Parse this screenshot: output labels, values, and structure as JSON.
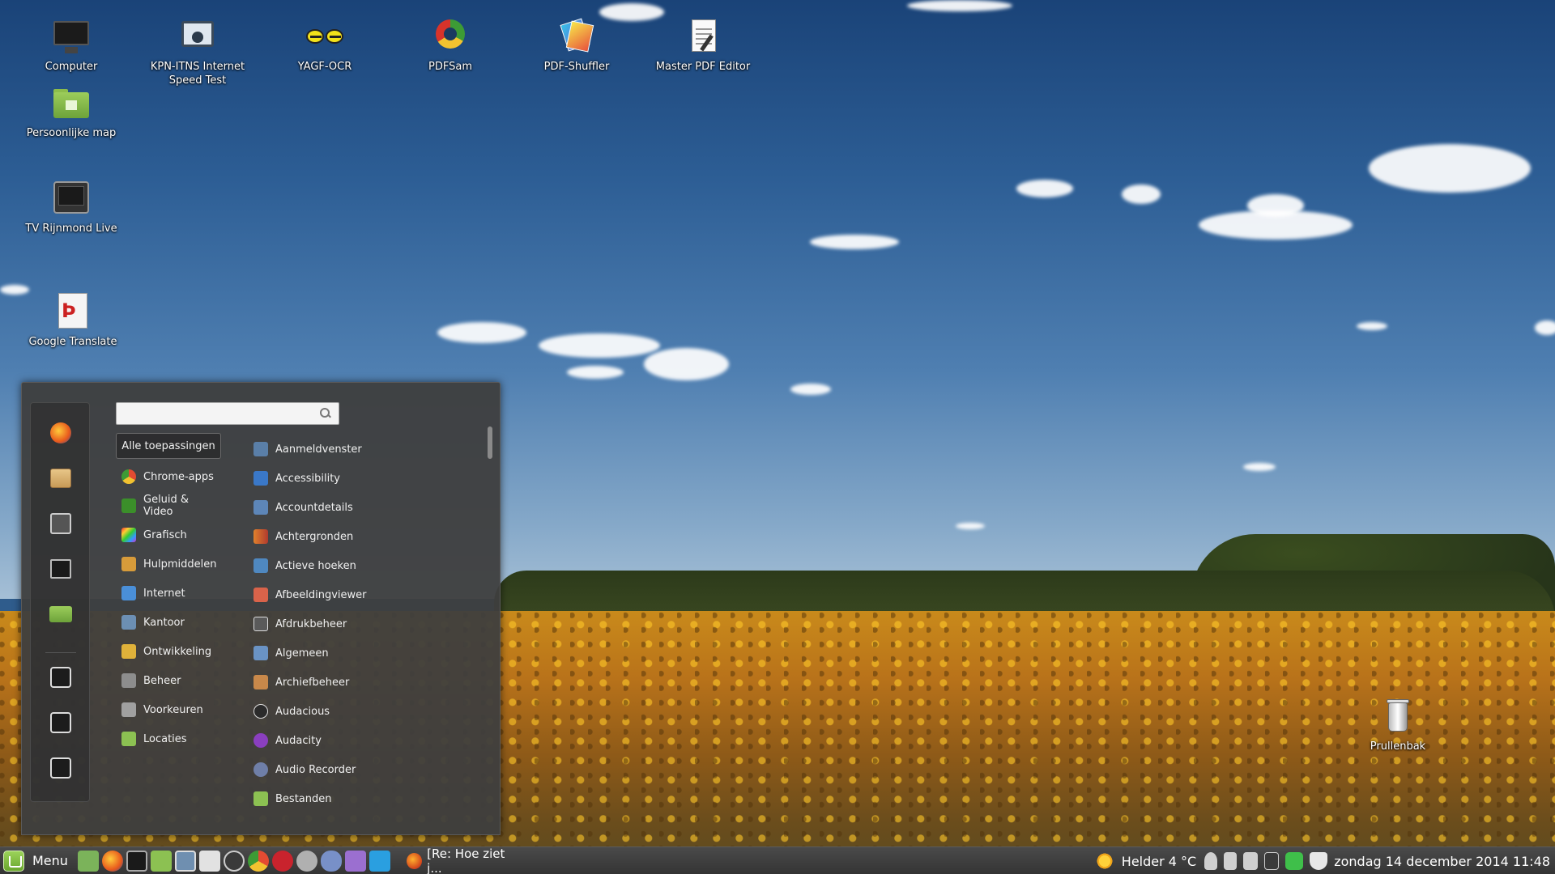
{
  "desktop": {
    "icons": [
      {
        "label": "Computer",
        "icon": "computer-icon"
      },
      {
        "label": "KPN-ITNS Internet Speed Test",
        "icon": "speedtest-icon"
      },
      {
        "label": "YAGF-OCR",
        "icon": "ocr-icon"
      },
      {
        "label": "PDFSam",
        "icon": "pdfsam-icon"
      },
      {
        "label": "PDF-Shuffler",
        "icon": "pdf-shuffler-icon"
      },
      {
        "label": "Master PDF Editor",
        "icon": "pdf-editor-icon"
      },
      {
        "label": "Persoonlijke map",
        "icon": "home-folder-icon"
      },
      {
        "label": "TV Rijnmond Live",
        "icon": "tv-icon"
      },
      {
        "label": "Google Translate",
        "icon": "translate-icon"
      },
      {
        "label": "Prullenbak",
        "icon": "trash-icon"
      }
    ]
  },
  "menu": {
    "search": {
      "value": "",
      "placeholder": ""
    },
    "favorites": [
      "firefox-icon",
      "package-icon",
      "settings-icon",
      "terminal-icon",
      "folder-icon",
      "lock-icon",
      "logout-icon",
      "power-icon"
    ],
    "categories": [
      {
        "label": "Alle toepassingen",
        "icon": "",
        "color": ""
      },
      {
        "label": "Chrome-apps",
        "icon": "chrome-icon",
        "color": "#e34b32"
      },
      {
        "label": "Geluid & Video",
        "icon": "media-icon",
        "color": "#3b8f2a"
      },
      {
        "label": "Grafisch",
        "icon": "graphics-icon",
        "color": "#c63fd0"
      },
      {
        "label": "Hulpmiddelen",
        "icon": "tools-icon",
        "color": "#d79b3a"
      },
      {
        "label": "Internet",
        "icon": "internet-icon",
        "color": "#4a8fd8"
      },
      {
        "label": "Kantoor",
        "icon": "office-icon",
        "color": "#6c8fb3"
      },
      {
        "label": "Ontwikkeling",
        "icon": "development-icon",
        "color": "#e0b23a"
      },
      {
        "label": "Beheer",
        "icon": "admin-icon",
        "color": "#8d8d8d"
      },
      {
        "label": "Voorkeuren",
        "icon": "preferences-icon",
        "color": "#a0a0a0"
      },
      {
        "label": "Locaties",
        "icon": "places-icon",
        "color": "#8cc152"
      }
    ],
    "apps": [
      {
        "label": "Aanmeldvenster",
        "icon": "login-window-icon",
        "color": "#5a7fa8"
      },
      {
        "label": "Accessibility",
        "icon": "accessibility-icon",
        "color": "#3a78c8"
      },
      {
        "label": "Accountdetails",
        "icon": "account-icon",
        "color": "#5d86b8"
      },
      {
        "label": "Achtergronden",
        "icon": "wallpaper-icon",
        "color": "#e0812c"
      },
      {
        "label": "Actieve hoeken",
        "icon": "hot-corners-icon",
        "color": "#4f88c0"
      },
      {
        "label": "Afbeeldingviewer",
        "icon": "image-viewer-icon",
        "color": "#d9634a"
      },
      {
        "label": "Afdrukbeheer",
        "icon": "printer-icon",
        "color": "#5a5a5a"
      },
      {
        "label": "Algemeen",
        "icon": "general-icon",
        "color": "#6a93c4"
      },
      {
        "label": "Archiefbeheer",
        "icon": "archive-icon",
        "color": "#c8884a"
      },
      {
        "label": "Audacious",
        "icon": "audacious-icon",
        "color": "#2b2b2b"
      },
      {
        "label": "Audacity",
        "icon": "audacity-icon",
        "color": "#8a3fbf"
      },
      {
        "label": "Audio Recorder",
        "icon": "microphone-icon",
        "color": "#6f7fa8"
      },
      {
        "label": "Bestanden",
        "icon": "files-icon",
        "color": "#8cc152"
      }
    ]
  },
  "taskbar": {
    "menu_label": "Menu",
    "launchers": [
      {
        "name": "files-launcher-icon",
        "color": "#7bb35a"
      },
      {
        "name": "firefox-launcher-icon",
        "color": "#e76f2a"
      },
      {
        "name": "terminal-launcher-icon",
        "color": "#222222"
      },
      {
        "name": "folder-launcher-icon",
        "color": "#8cc152"
      },
      {
        "name": "screenshot-launcher-icon",
        "color": "#6f8fb0"
      },
      {
        "name": "text-editor-launcher-icon",
        "color": "#d8d8d8"
      },
      {
        "name": "rhythmbox-launcher-icon",
        "color": "#3a3a3a"
      },
      {
        "name": "chrome-launcher-icon",
        "color": "#e0432c"
      },
      {
        "name": "cherry-launcher-icon",
        "color": "#c9232d"
      },
      {
        "name": "audacious-launcher-icon",
        "color": "#b0b0b0"
      },
      {
        "name": "microphone-launcher-icon",
        "color": "#7890c8"
      },
      {
        "name": "media-launcher-icon",
        "color": "#9b6fd0"
      },
      {
        "name": "skype-launcher-icon",
        "color": "#2a9fe0"
      }
    ],
    "window_title": "[Re: Hoe ziet j...",
    "weather": "Helder 4 °C",
    "clock": "zondag 14 december 2014  11:48",
    "tray_icons": [
      "user-icon",
      "network-icon",
      "volume-icon",
      "update-icon",
      "shield-check-icon",
      "security-icon"
    ]
  }
}
